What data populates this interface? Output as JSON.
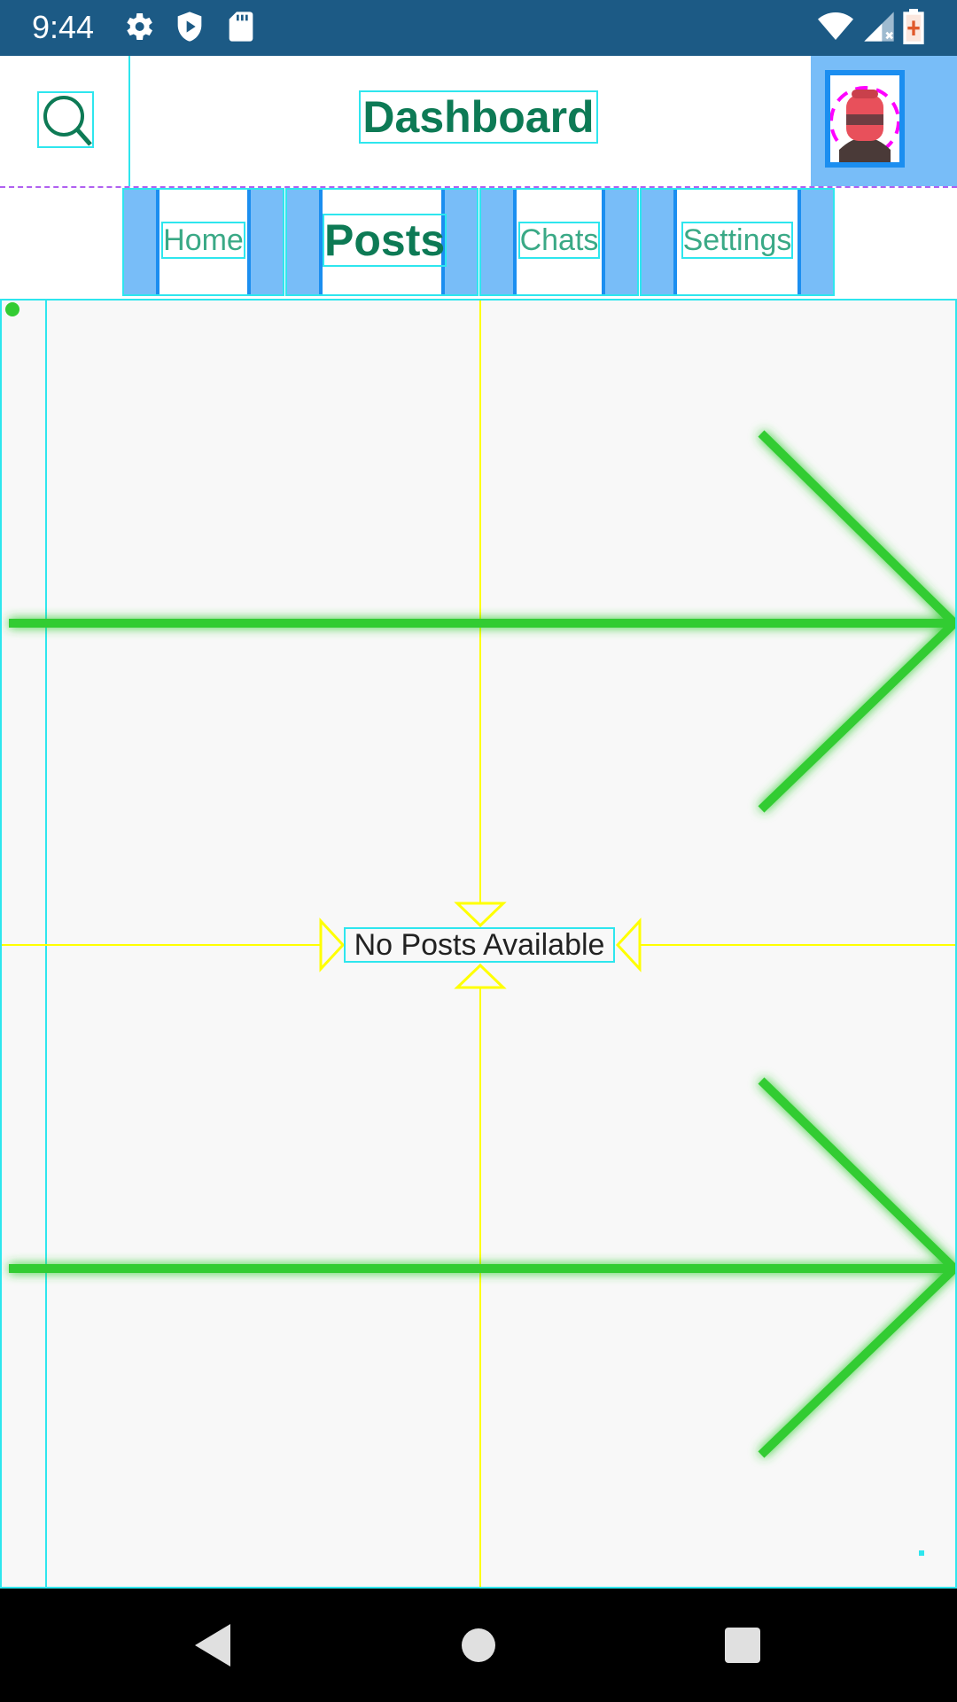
{
  "status_bar": {
    "time": "9:44",
    "icons": [
      "settings-icon",
      "play-protect-icon",
      "sd-card-icon",
      "wifi-icon",
      "cell-signal-icon",
      "battery-icon"
    ]
  },
  "app_bar": {
    "title": "Dashboard",
    "search_icon": "search-icon",
    "avatar_icon": "avatar-icon"
  },
  "tabs": [
    {
      "label": "Home",
      "active": false
    },
    {
      "label": "Posts",
      "active": true
    },
    {
      "label": "Chats",
      "active": false
    },
    {
      "label": "Settings",
      "active": false
    }
  ],
  "content": {
    "empty_message": "No Posts Available"
  },
  "nav_bar": {
    "back_icon": "back-icon",
    "home_icon": "home-icon",
    "recents_icon": "recents-icon"
  },
  "colors": {
    "status_bar": "#1c5a85",
    "accent_text": "#0d7a55",
    "tab_inactive_text": "#3aa986",
    "tab_frame": "#78bdf8",
    "debug_outline": "#2ee6ee",
    "guide_line": "#ffff00",
    "arrow": "#33cc33"
  }
}
